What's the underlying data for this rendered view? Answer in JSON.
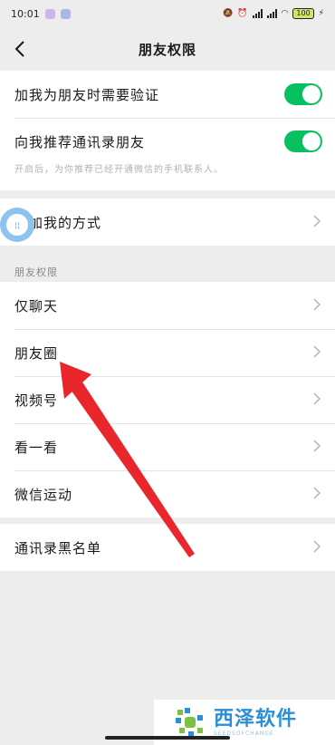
{
  "status_bar": {
    "time": "10:01",
    "battery": "100"
  },
  "header": {
    "title": "朋友权限"
  },
  "verify_section": {
    "items": [
      {
        "label": "加我为朋友时需要验证",
        "enabled": true
      },
      {
        "label": "向我推荐通讯录朋友",
        "enabled": true
      }
    ],
    "hint": "开启后，为你推荐已经开通微信的手机联系人。"
  },
  "add_method": {
    "label": "添加我的方式"
  },
  "permissions_section": {
    "header": "朋友权限",
    "items": [
      "仅聊天",
      "朋友圈",
      "视频号",
      "看一看",
      "微信运动"
    ]
  },
  "blacklist": {
    "label": "通讯录黑名单"
  },
  "watermark": {
    "title": "西泽软件",
    "subtitle": "SEEDSOFCHANGE"
  },
  "colors": {
    "accent": "#07c160",
    "annotation_arrow": "#e8262b",
    "background": "#ededed"
  }
}
